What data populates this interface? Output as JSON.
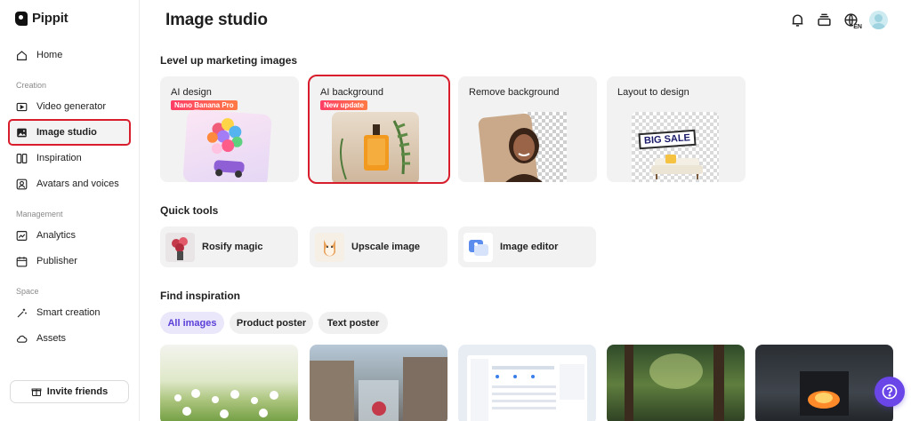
{
  "app": {
    "name": "Pippit"
  },
  "sidebar": {
    "home": "Home",
    "sections": [
      {
        "label": "Creation",
        "items": [
          "Video generator",
          "Image studio",
          "Inspiration",
          "Avatars and voices"
        ]
      },
      {
        "label": "Management",
        "items": [
          "Analytics",
          "Publisher"
        ]
      },
      {
        "label": "Space",
        "items": [
          "Smart creation",
          "Assets"
        ]
      }
    ],
    "active_item": "Image studio",
    "invite": "Invite friends"
  },
  "header": {
    "title": "Image studio",
    "lang": "EN"
  },
  "marketing": {
    "title": "Level up marketing images",
    "cards": [
      {
        "title": "AI design",
        "badge": "Nano Banana Pro"
      },
      {
        "title": "AI background",
        "badge": "New update"
      },
      {
        "title": "Remove background",
        "badge": ""
      },
      {
        "title": "Layout to design",
        "badge": "",
        "art_text": "BIG SALE"
      }
    ]
  },
  "quick_tools": {
    "title": "Quick tools",
    "items": [
      "Rosify magic",
      "Upscale image",
      "Image editor"
    ]
  },
  "inspiration": {
    "title": "Find inspiration",
    "filters": [
      "All images",
      "Product poster",
      "Text poster"
    ],
    "active_filter": "All images"
  },
  "colors": {
    "accent": "#6a45e8",
    "highlight": "#d81e2c",
    "badge": "#ff3d67"
  }
}
